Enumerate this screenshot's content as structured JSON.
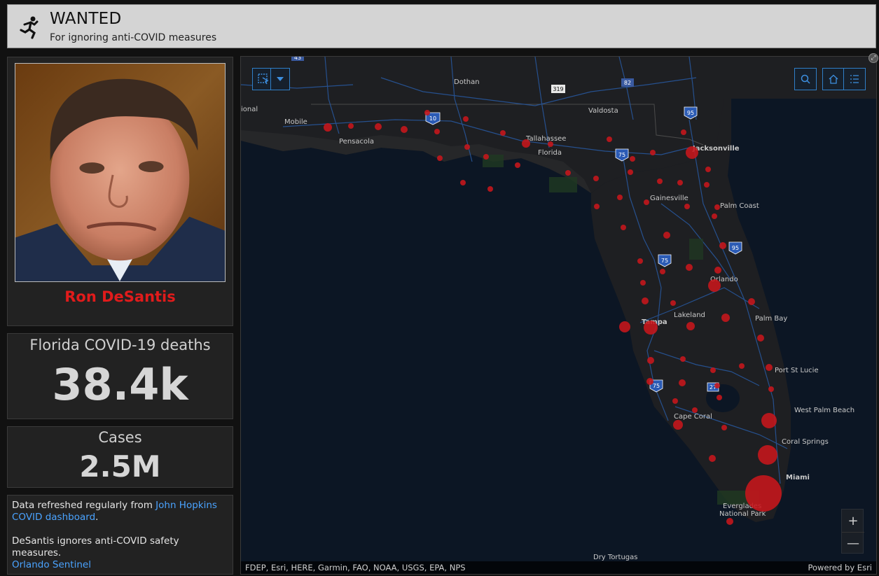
{
  "header": {
    "title": "WANTED",
    "subtitle": "For ignoring anti-COVID measures"
  },
  "profile": {
    "name": "Ron DeSantis"
  },
  "deaths": {
    "label": "Florida COVID-19 deaths",
    "value": "38.4k"
  },
  "cases": {
    "label": "Cases",
    "value": "2.5M"
  },
  "info": {
    "line1_text": "Data refreshed regularly from ",
    "line1_link": "John Hopkins COVID dashboard",
    "line1_end": ".",
    "line2_text": "DeSantis ignores anti-COVID safety measures.",
    "line2_link": "Orlando Sentinel"
  },
  "map": {
    "attribution": "FDEP, Esri, HERE, Garmin, FAO, NOAA, USGS, EPA, NPS",
    "powered_by": "Powered by Esri",
    "zoom_in": "+",
    "zoom_out": "—",
    "labels": {
      "dothan": "Dothan",
      "valdosta": "Valdosta",
      "mobile": "Mobile",
      "pensacola": "Pensacola",
      "tallahassee": "Tallahassee",
      "florida": "Florida",
      "jacksonville": "Jacksonville",
      "gainesville": "Gainesville",
      "palm_coast": "Palm Coast",
      "orlando": "Orlando",
      "lakeland": "Lakeland",
      "tampa": "Tampa",
      "palm_bay": "Palm Bay",
      "port_st_lucie": "Port St Lucie",
      "west_palm_beach": "West Palm Beach",
      "cape_coral": "Cape Coral",
      "coral_springs": "Coral Springs",
      "miami": "Miami",
      "everglades": "Everglades National Park",
      "dry_tortugas": "Dry Tortugas",
      "national_frag": "National Park",
      "regional": "ional"
    },
    "shields": [
      "43",
      "319",
      "82",
      "95",
      "10",
      "75",
      "95",
      "75",
      "75",
      "27"
    ]
  },
  "colors": {
    "accent_red": "#e11b1b",
    "link_blue": "#4aa3ff",
    "map_bg": "#0c1624",
    "dot_red": "#c8161c"
  }
}
